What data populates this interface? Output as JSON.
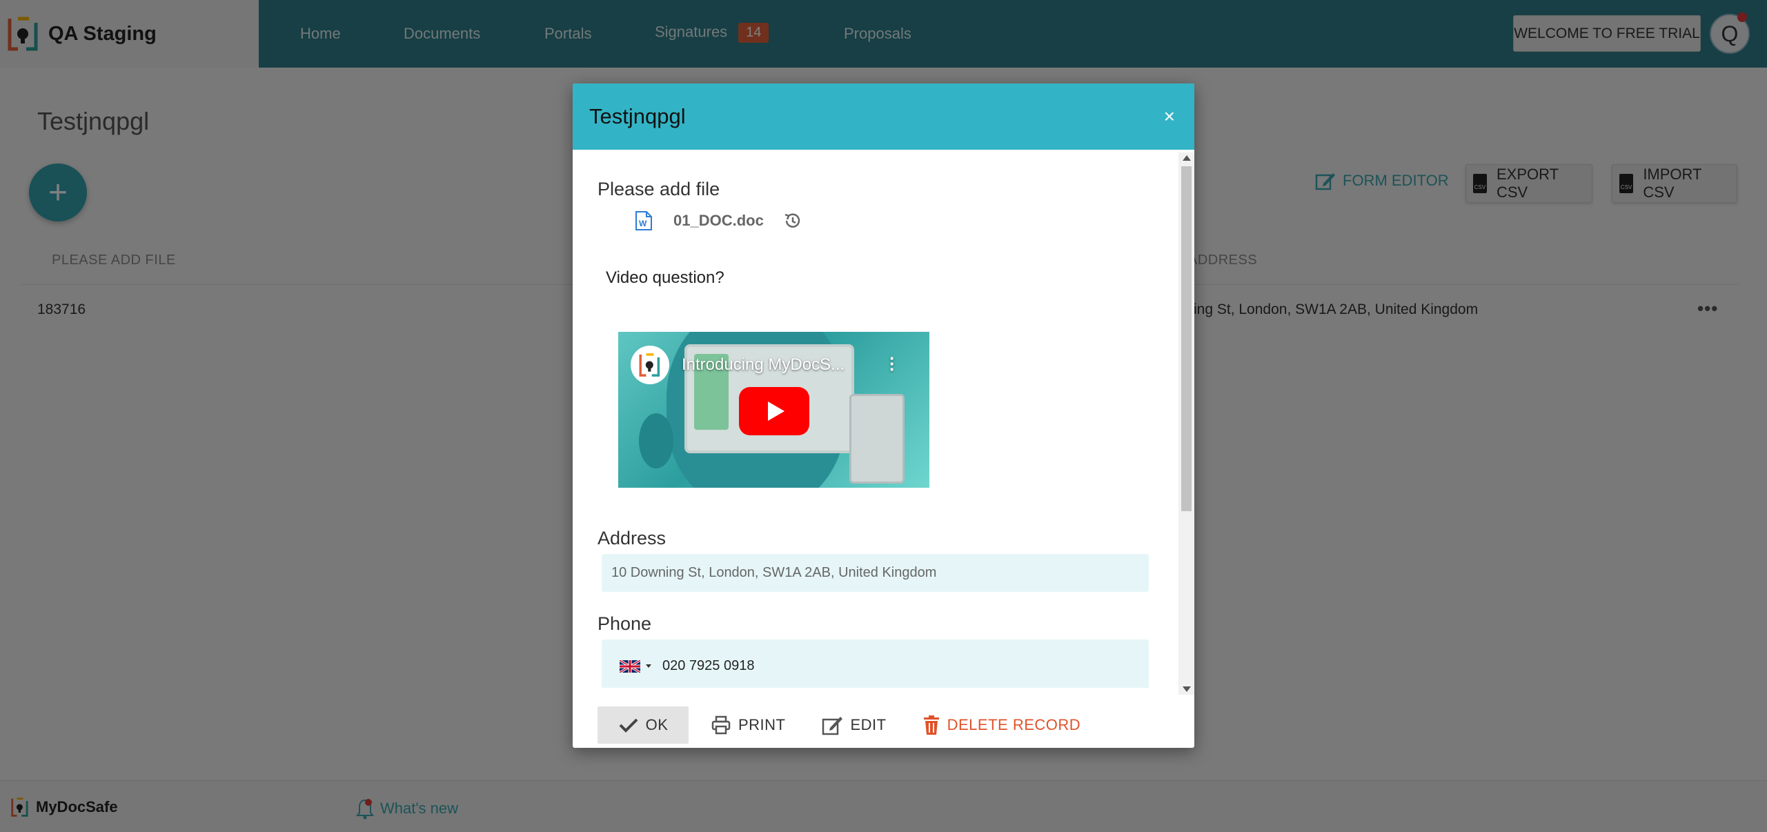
{
  "app": {
    "name": "QA Staging",
    "footer_brand": "MyDocSafe",
    "whats_new": "What's new"
  },
  "nav": {
    "items": [
      {
        "label": "Home"
      },
      {
        "label": "Documents"
      },
      {
        "label": "Portals"
      },
      {
        "label": "Signatures",
        "badge": "14"
      },
      {
        "label": "Proposals"
      }
    ],
    "trial_button": "WELCOME TO FREE TRIAL",
    "avatar_letter": "Q"
  },
  "page": {
    "title": "Testjnqpgl",
    "fab_label": "+",
    "form_editor": "FORM EDITOR",
    "export_csv": "EXPORT CSV",
    "import_csv": "IMPORT CSV",
    "csv_icon_text": "CSV",
    "table": {
      "columns": [
        "PLEASE ADD FILE",
        "ADDRESS"
      ],
      "rows": [
        {
          "file": "183716",
          "address": "ing St, London, SW1A 2AB, United Kingdom"
        }
      ],
      "row_menu": "•••"
    }
  },
  "modal": {
    "title": "Testjnqpgl",
    "close": "×",
    "file_label": "Please add file",
    "file_name": "01_DOC.doc",
    "video_question": "Video question?",
    "video_title": "Introducing MyDocS...",
    "address_label": "Address",
    "address_value": "10 Downing St, London, SW1A 2AB, United Kingdom",
    "phone_label": "Phone",
    "phone_value": "020 7925 0918",
    "buttons": {
      "ok": "OK",
      "print": "PRINT",
      "edit": "EDIT",
      "delete": "DELETE RECORD"
    }
  },
  "colors": {
    "topbar": "#2e7f8a",
    "modal_header": "#33b4c6",
    "accent": "#3aa6b0",
    "badge": "#e0603a",
    "delete": "#e0522a"
  }
}
